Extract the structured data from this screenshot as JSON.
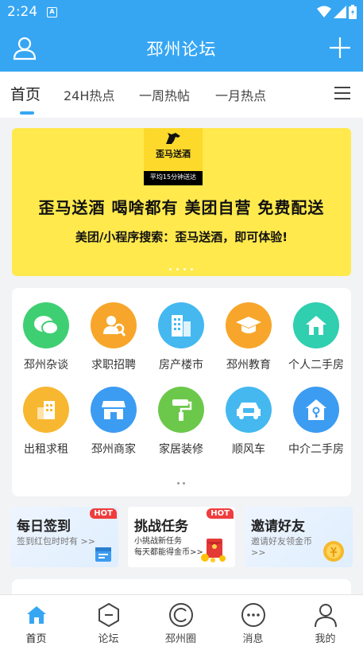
{
  "status_bar": {
    "time": "2:24",
    "notification_letter": "A"
  },
  "app_bar": {
    "title": "邳州论坛"
  },
  "tabs": [
    {
      "label": "首页"
    },
    {
      "label": "24H热点"
    },
    {
      "label": "一周热帖"
    },
    {
      "label": "一月热点"
    }
  ],
  "banner": {
    "brand_name": "歪马送酒",
    "brand_slogan": "平均15分钟送达",
    "headline": "歪马送酒  喝啥都有 美团自营 免费配送",
    "subline": "美团/小程序搜索：歪马送酒，即可体验!"
  },
  "categories": [
    {
      "label": "邳州杂谈",
      "icon": "chat-bubbles-icon",
      "color": "#3fcf73"
    },
    {
      "label": "求职招聘",
      "icon": "job-search-icon",
      "color": "#f7a62b"
    },
    {
      "label": "房产楼市",
      "icon": "buildings-icon",
      "color": "#45b8f0"
    },
    {
      "label": "邳州教育",
      "icon": "graduation-cap-icon",
      "color": "#f7a62b"
    },
    {
      "label": "个人二手房",
      "icon": "house-icon",
      "color": "#2fcfb0"
    },
    {
      "label": "出租求租",
      "icon": "building-icon",
      "color": "#f7b731"
    },
    {
      "label": "邳州商家",
      "icon": "storefront-icon",
      "color": "#3c9cf2"
    },
    {
      "label": "家居装修",
      "icon": "paint-roller-icon",
      "color": "#6cc84a"
    },
    {
      "label": "顺风车",
      "icon": "car-icon",
      "color": "#45b8f0"
    },
    {
      "label": "中介二手房",
      "icon": "house-key-icon",
      "color": "#3c9cf2"
    }
  ],
  "promos": [
    {
      "title": "每日签到",
      "subtitle": "签到红包时时有 >>",
      "badge": "HOT",
      "icon": "calendar-icon"
    },
    {
      "title": "挑战任务",
      "subtitle": "小挑战新任务\n每天都能得金币>>",
      "badge": "HOT",
      "icon": "red-envelope-icon"
    },
    {
      "title": "邀请好友",
      "subtitle": "邀请好友领金币 >>",
      "icon": "coin-icon"
    }
  ],
  "bottom_nav": [
    {
      "label": "首页",
      "icon": "home-icon",
      "active": true
    },
    {
      "label": "论坛",
      "icon": "forum-icon"
    },
    {
      "label": "邳州圈",
      "icon": "circle-icon"
    },
    {
      "label": "消息",
      "icon": "message-icon"
    },
    {
      "label": "我的",
      "icon": "profile-icon"
    }
  ],
  "colors": {
    "primary": "#36a6f3",
    "banner_bg": "#ffe94c",
    "hot_badge": "#f03c3c"
  }
}
